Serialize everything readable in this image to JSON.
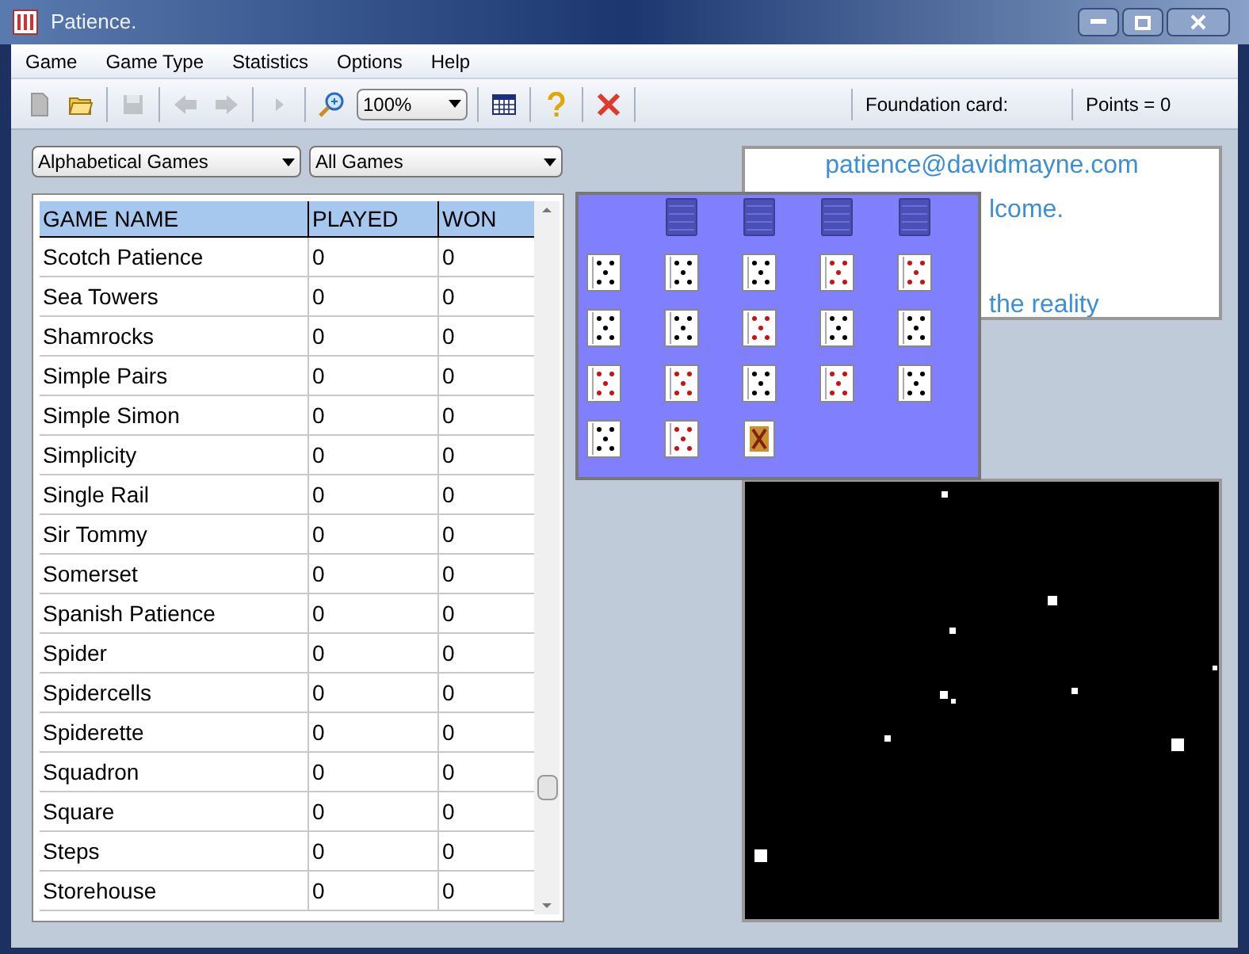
{
  "window": {
    "title": "Patience."
  },
  "menu": [
    "Game",
    "Game Type",
    "Statistics",
    "Options",
    "Help"
  ],
  "toolbar": {
    "buttons": [
      {
        "kind": "new",
        "disabled": false
      },
      {
        "kind": "open",
        "disabled": false
      },
      {
        "kind": "sep"
      },
      {
        "kind": "save",
        "disabled": true
      },
      {
        "kind": "sep"
      },
      {
        "kind": "back",
        "disabled": true
      },
      {
        "kind": "forward",
        "disabled": true
      },
      {
        "kind": "sep"
      },
      {
        "kind": "play",
        "disabled": true
      },
      {
        "kind": "sep"
      },
      {
        "kind": "zoom",
        "disabled": false
      }
    ],
    "zoom_value": "100%",
    "buttons2": [
      {
        "kind": "grid",
        "disabled": false
      },
      {
        "kind": "help",
        "disabled": false
      },
      {
        "kind": "close",
        "disabled": false
      }
    ],
    "foundation_label": "Foundation card:",
    "points": "Points = 0"
  },
  "filters": [
    {
      "value": "Alphabetical Games"
    },
    {
      "value": "All Games"
    }
  ],
  "table": {
    "columns": [
      "GAME NAME",
      "PLAYED",
      "WON"
    ],
    "rows": [
      [
        "Scotch Patience",
        "0",
        "0"
      ],
      [
        "Sea Towers",
        "0",
        "0"
      ],
      [
        "Shamrocks",
        "0",
        "0"
      ],
      [
        "Simple Pairs",
        "0",
        "0"
      ],
      [
        "Simple Simon",
        "0",
        "0"
      ],
      [
        "Simplicity",
        "0",
        "0"
      ],
      [
        "Single Rail",
        "0",
        "0"
      ],
      [
        "Sir Tommy",
        "0",
        "0"
      ],
      [
        "Somerset",
        "0",
        "0"
      ],
      [
        "Spanish Patience",
        "0",
        "0"
      ],
      [
        "Spider",
        "0",
        "0"
      ],
      [
        "Spidercells",
        "0",
        "0"
      ],
      [
        "Spiderette",
        "0",
        "0"
      ],
      [
        "Squadron",
        "0",
        "0"
      ],
      [
        "Square",
        "0",
        "0"
      ],
      [
        "Steps",
        "0",
        "0"
      ],
      [
        "Storehouse",
        "0",
        "0"
      ]
    ]
  },
  "info_lines": [
    "patience@davidmayne.com",
    "lcome.",
    "the reality"
  ],
  "preview": {
    "rows": [
      [
        {
          "kind": "empty"
        },
        {
          "kind": "back"
        },
        {
          "kind": "back"
        },
        {
          "kind": "back"
        },
        {
          "kind": "back"
        }
      ],
      [
        {
          "kind": "black"
        },
        {
          "kind": "black"
        },
        {
          "kind": "black"
        },
        {
          "kind": "red"
        },
        {
          "kind": "red"
        }
      ],
      [
        {
          "kind": "black"
        },
        {
          "kind": "black"
        },
        {
          "kind": "red"
        },
        {
          "kind": "black"
        },
        {
          "kind": "black"
        }
      ],
      [
        {
          "kind": "red"
        },
        {
          "kind": "red"
        },
        {
          "kind": "black"
        },
        {
          "kind": "red"
        },
        {
          "kind": "black"
        }
      ],
      [
        {
          "kind": "black"
        },
        {
          "kind": "red"
        },
        {
          "kind": "court"
        }
      ]
    ]
  }
}
